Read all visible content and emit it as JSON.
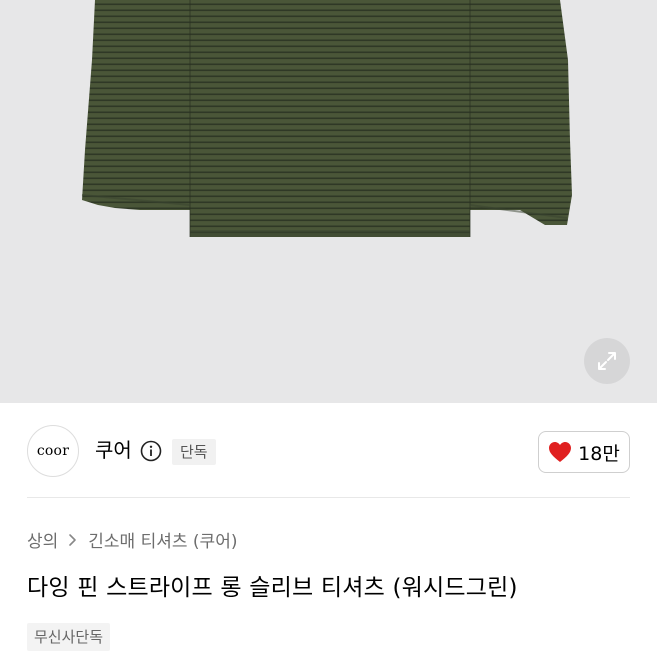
{
  "hero": {
    "image_alt": "product-image-green-striped-long-sleeve",
    "zoom_icon": "expand-arrows-icon"
  },
  "brand": {
    "logo_text": "coor",
    "name": "쿠어",
    "info_icon": "info-circle-icon",
    "badge": "단독"
  },
  "like": {
    "icon": "heart-icon",
    "count": "18만",
    "color": "#e02020"
  },
  "breadcrumb": {
    "items": [
      "상의",
      "긴소매 티셔츠 (쿠어)"
    ],
    "separator_icon": "chevron-right-icon"
  },
  "product": {
    "title": "다잉 핀 스트라이프 롱 슬리브 티셔츠 (워시드그린)",
    "tag": "무신사단독"
  }
}
